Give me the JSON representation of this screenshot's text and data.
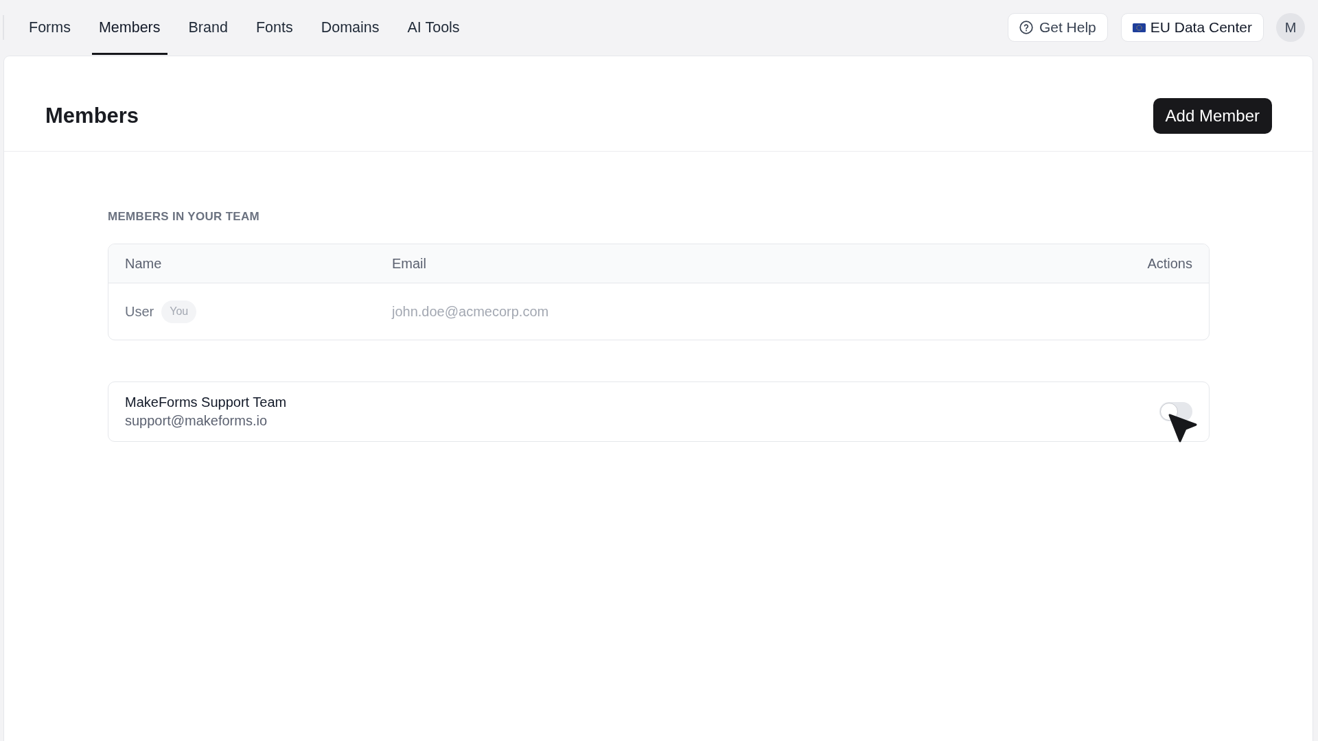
{
  "nav": {
    "tabs": [
      {
        "label": "Forms",
        "selected": false
      },
      {
        "label": "Members",
        "selected": true
      },
      {
        "label": "Brand",
        "selected": false
      },
      {
        "label": "Fonts",
        "selected": false
      },
      {
        "label": "Domains",
        "selected": false
      },
      {
        "label": "AI Tools",
        "selected": false
      }
    ]
  },
  "header_actions": {
    "help_button": "Get Help",
    "region_button": "EU Data Center",
    "avatar": "M"
  },
  "page": {
    "title": "Members",
    "primary_button": "Add Member"
  },
  "team": {
    "section_title": "MEMBERS IN YOUR TEAM",
    "table": {
      "columns": [
        "Name",
        "Email",
        "Actions"
      ],
      "rows": [
        {
          "name": "User",
          "badge": "You",
          "email": "john.doe@acmecorp.com"
        }
      ]
    }
  },
  "support": {
    "name": "MakeForms Support Team",
    "email": "support@makeforms.io",
    "access_on": false
  }
}
